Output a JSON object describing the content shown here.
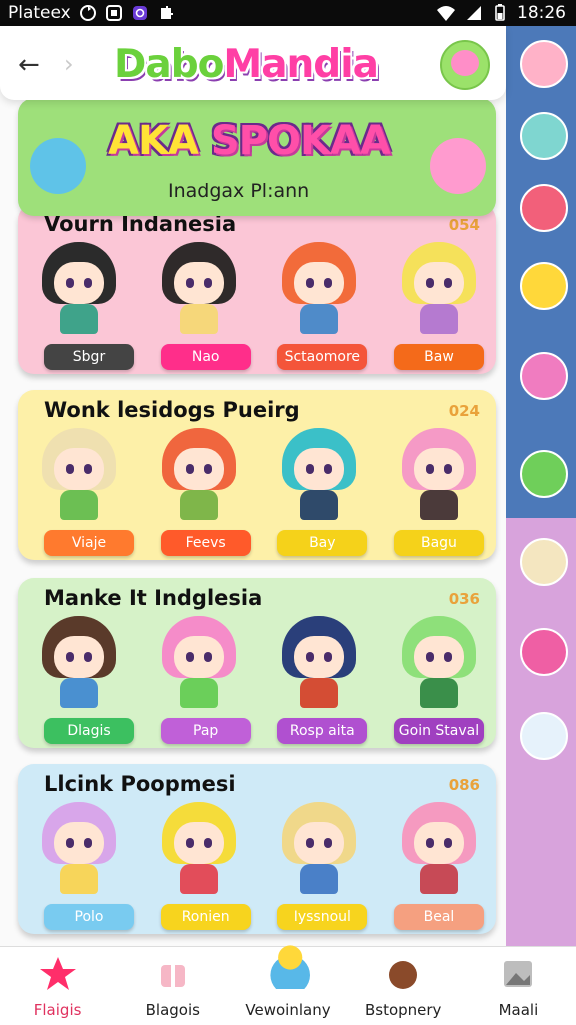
{
  "status": {
    "carrier": "Plateex",
    "time": "18:26"
  },
  "header": {
    "logo_word1": "Dabo",
    "logo_word2": "Mandia"
  },
  "banner": {
    "title_a": "AKA ",
    "title_b": "SPOKAA",
    "subtitle": "Inadgax Pl:ann"
  },
  "cards": [
    {
      "title": "Vourn Indanesia",
      "num": "054",
      "bg": "#fbc6d6",
      "chars": [
        {
          "hair": "#2b2b2b",
          "body": "#3fa38a"
        },
        {
          "hair": "#2f2a2a",
          "body": "#f6d77a"
        },
        {
          "hair": "#f26b3a",
          "body": "#4f8bc9"
        },
        {
          "hair": "#f5e15a",
          "body": "#b57ad0"
        }
      ],
      "buttons": [
        {
          "label": "Sbgr",
          "color": "#444"
        },
        {
          "label": "Nao",
          "color": "#ff2e8a"
        },
        {
          "label": "Sctaomore",
          "color": "#f4553a"
        },
        {
          "label": "Baw",
          "color": "#f46a1a"
        }
      ]
    },
    {
      "title": "Wonk lesidogs Pueirg",
      "num": "024",
      "bg": "#fdf0a8",
      "chars": [
        {
          "hair": "#efe0b0",
          "body": "#6cbf53"
        },
        {
          "hair": "#f0663e",
          "body": "#7fb64a"
        },
        {
          "hair": "#3bc0c8",
          "body": "#2f4a6a"
        },
        {
          "hair": "#f59ac6",
          "body": "#4b3a3a"
        }
      ],
      "buttons": [
        {
          "label": "Viaje",
          "color": "#ff7a2e"
        },
        {
          "label": "Feevs",
          "color": "#ff5a2a"
        },
        {
          "label": "Bay",
          "color": "#f5d21a"
        },
        {
          "label": "Bagu",
          "color": "#f5d21a"
        }
      ]
    },
    {
      "title": "Manke It Indglesia",
      "num": "036",
      "bg": "#d6f2c8",
      "chars": [
        {
          "hair": "#5a3a2a",
          "body": "#4a90d0"
        },
        {
          "hair": "#f58cc9",
          "body": "#6bcf5a"
        },
        {
          "hair": "#2a3f7a",
          "body": "#d44d34"
        },
        {
          "hair": "#8ee07a",
          "body": "#3a8f4a"
        }
      ],
      "buttons": [
        {
          "label": "Dlagis",
          "color": "#3cc060"
        },
        {
          "label": "Pap",
          "color": "#c060d8"
        },
        {
          "label": "Rosp aita",
          "color": "#b050d0"
        },
        {
          "label": "Goin Staval",
          "color": "#a040c0"
        }
      ]
    },
    {
      "title": "Llcink Poopmesi",
      "num": "086",
      "bg": "#cfeaf7",
      "chars": [
        {
          "hair": "#d8a6ea",
          "body": "#f7d55a"
        },
        {
          "hair": "#f5dc3a",
          "body": "#e24d5a"
        },
        {
          "hair": "#f0d88a",
          "body": "#4a80c8"
        },
        {
          "hair": "#f59ac0",
          "body": "#c74a56"
        }
      ],
      "buttons": [
        {
          "label": "Polo",
          "color": "#79cbf0"
        },
        {
          "label": "Ronien",
          "color": "#f7d41e"
        },
        {
          "label": "Iyssnoul",
          "color": "#f7d41e"
        },
        {
          "label": "Beal",
          "color": "#f5a080"
        }
      ]
    }
  ],
  "nav": [
    {
      "label": "Flaigis",
      "active": true,
      "color": "#ff2e6a"
    },
    {
      "label": "Blagois",
      "active": false,
      "color": "#f08aa0"
    },
    {
      "label": "Vewoinlany",
      "active": false,
      "color": "#58b8e8"
    },
    {
      "label": "Bstopnery",
      "active": false,
      "color": "#8a4a2a"
    },
    {
      "label": "Maali",
      "active": false,
      "color": "#9a9a9a"
    }
  ]
}
